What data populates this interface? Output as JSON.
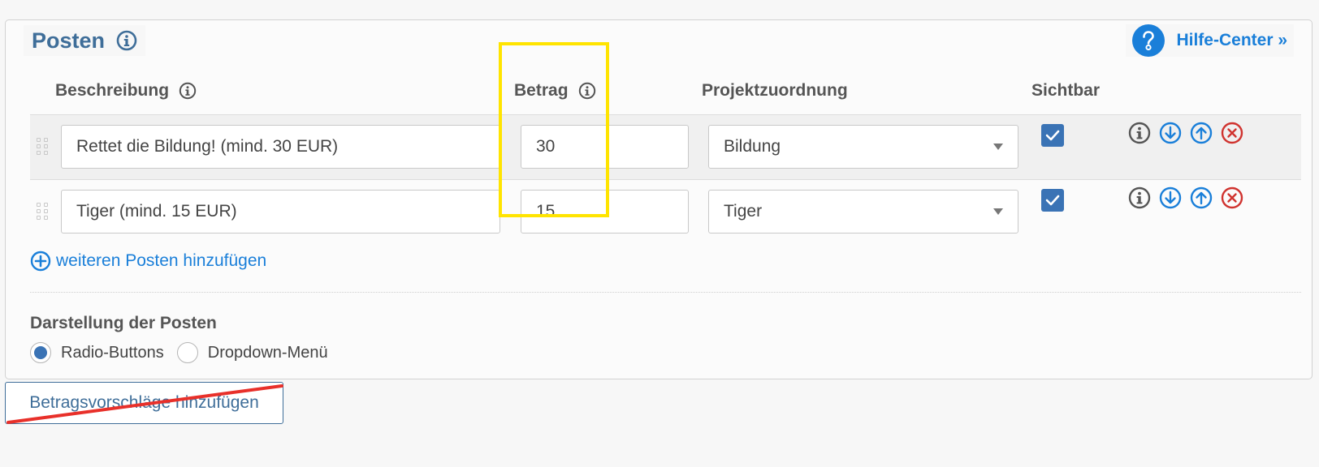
{
  "section": {
    "title": "Posten",
    "help_link": "Hilfe-Center »"
  },
  "columns": {
    "description": "Beschreibung",
    "amount": "Betrag",
    "project": "Projektzuordnung",
    "visible": "Sichtbar"
  },
  "items": [
    {
      "description": "Rettet die Bildung! (mind. 30 EUR)",
      "amount": "30",
      "project": "Bildung",
      "visible": true
    },
    {
      "description": "Tiger (mind. 15 EUR)",
      "amount": "15",
      "project": "Tiger",
      "visible": true
    }
  ],
  "add_item_label": "weiteren Posten hinzufügen",
  "display": {
    "label": "Darstellung der Posten",
    "options": [
      "Radio-Buttons",
      "Dropdown-Menü"
    ],
    "selected": "Radio-Buttons"
  },
  "amount_suggestions_button": "Betragsvorschläge hinzufügen",
  "colors": {
    "accent": "#3f6e99",
    "link": "#1a7fd9",
    "checkbox": "#3a73b5",
    "delete": "#d0332f",
    "highlight": "#ffe400",
    "strike": "#e8302a"
  },
  "icons": {
    "info": "info-icon",
    "help": "question-icon",
    "move_down": "arrow-down-icon",
    "move_up": "arrow-up-icon",
    "delete": "close-circle-icon",
    "add": "plus-circle-icon"
  }
}
